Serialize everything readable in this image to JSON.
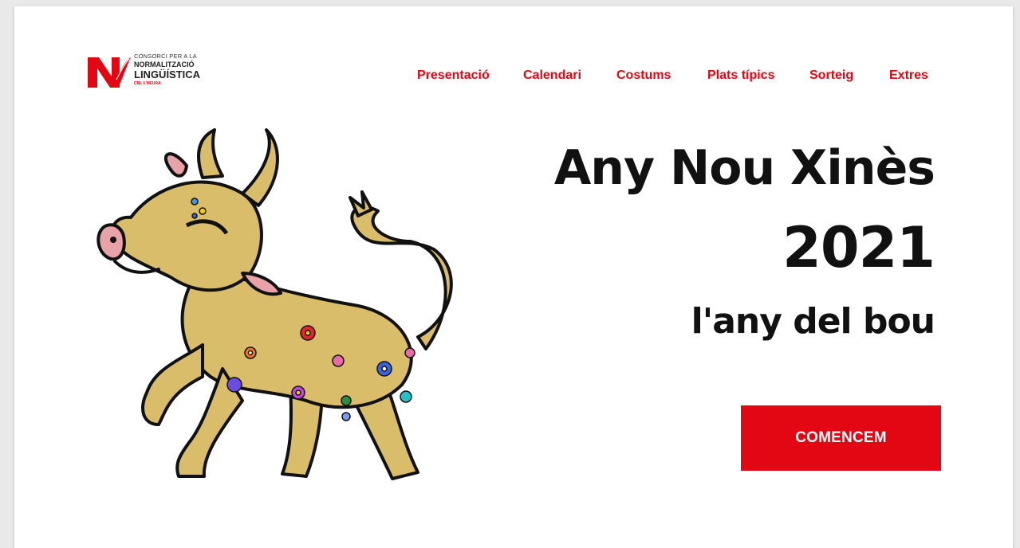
{
  "logo": {
    "line1": "CONSORCI PER A LA",
    "line2": "NORMALITZACIÓ",
    "line3": "LINGÜÍSTICA",
    "line4": "CNL L'HEURA"
  },
  "nav": {
    "items": [
      {
        "label": "Presentació"
      },
      {
        "label": "Calendari"
      },
      {
        "label": "Costums"
      },
      {
        "label": "Plats típics"
      },
      {
        "label": "Sorteig"
      },
      {
        "label": "Extres"
      }
    ]
  },
  "hero": {
    "title": "Any Nou Xinès",
    "year": "2021",
    "subtitle": "l'any del bou"
  },
  "cta": {
    "label": "COMENCEM"
  },
  "colors": {
    "accent": "#e30613",
    "text": "#111111",
    "ox_body": "#d9bd6a",
    "ox_pink": "#e8a3a8"
  },
  "illustration": {
    "icon": "ox-illustration"
  }
}
